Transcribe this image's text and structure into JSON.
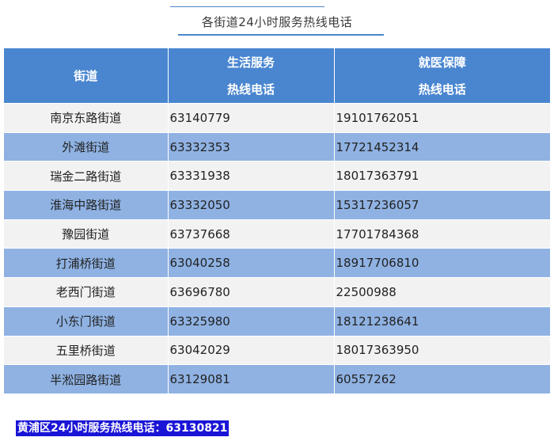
{
  "title": "各街道24小时服务热线电话",
  "table": {
    "headers": {
      "street": "街道",
      "life_line1": "生活服务",
      "life_line2": "热线电话",
      "med_line1": "就医保障",
      "med_line2": "热线电话"
    },
    "rows": [
      {
        "street": "南京东路街道",
        "life": "63140779",
        "medical": "19101762051"
      },
      {
        "street": "外滩街道",
        "life": "63332353",
        "medical": "17721452314"
      },
      {
        "street": "瑞金二路街道",
        "life": "63331938",
        "medical": "18017363791"
      },
      {
        "street": "淮海中路街道",
        "life": "63332050",
        "medical": "15317236057"
      },
      {
        "street": "豫园街道",
        "life": "63737668",
        "medical": "17701784368"
      },
      {
        "street": "打浦桥街道",
        "life": "63040258",
        "medical": "18917706810"
      },
      {
        "street": "老西门街道",
        "life": "63696780",
        "medical": "22500988"
      },
      {
        "street": "小东门街道",
        "life": "63325980",
        "medical": "18121238641"
      },
      {
        "street": "五里桥街道",
        "life": "63042029",
        "medical": "18017363950"
      },
      {
        "street": "半淞园路街道",
        "life": "63129081",
        "medical": "60557262"
      }
    ]
  },
  "footer": "黄浦区24小时服务热线电话：63130821",
  "colors": {
    "header_bg": "#4a86d0",
    "row_light": "#f2f2f2",
    "row_blue": "#8fb2e3",
    "footer_bg": "#1a14d6",
    "accent_line": "#4a86c8"
  }
}
